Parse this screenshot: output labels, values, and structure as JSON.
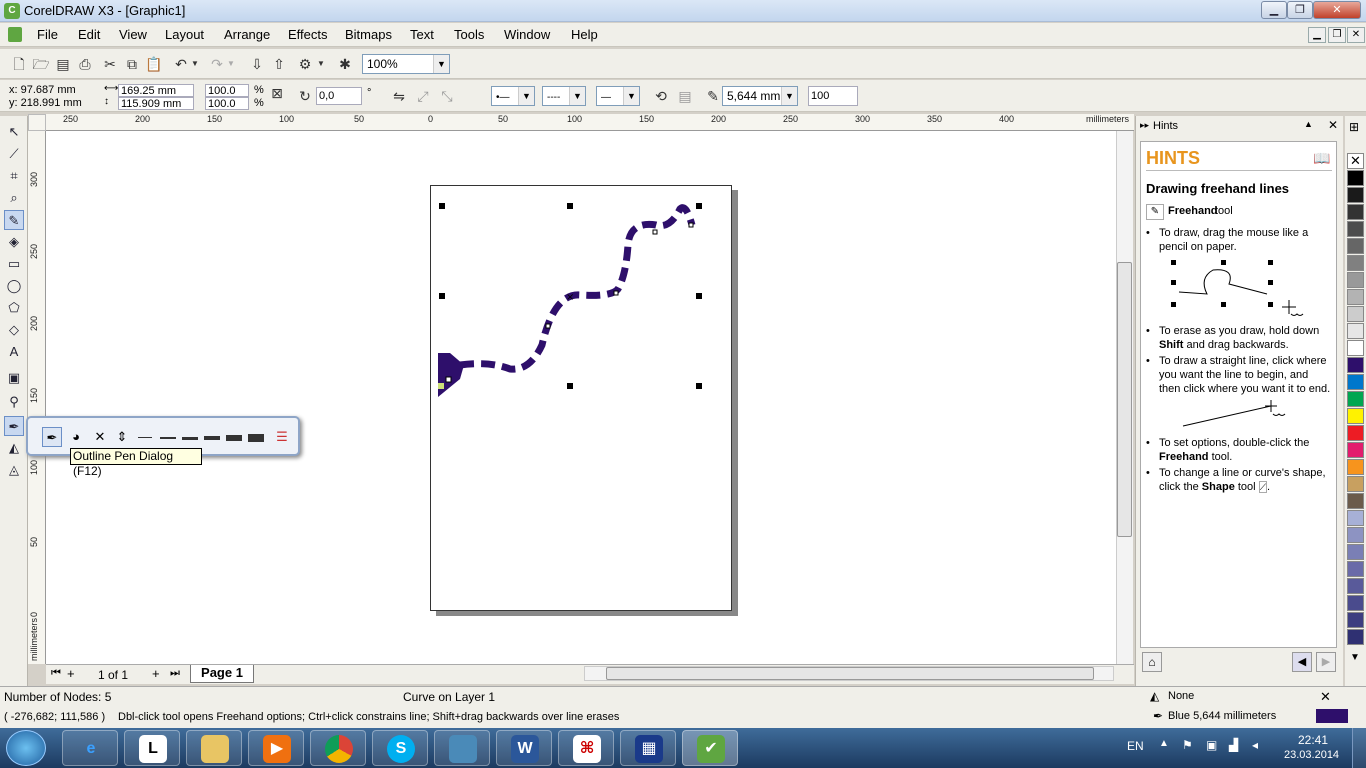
{
  "window": {
    "title": "CorelDRAW X3 - [Graphic1]",
    "min": "▁",
    "max": "❐",
    "close": "✕"
  },
  "menu": [
    "File",
    "Edit",
    "View",
    "Layout",
    "Arrange",
    "Effects",
    "Bitmaps",
    "Text",
    "Tools",
    "Window",
    "Help"
  ],
  "toolbar": {
    "zoom": "100%"
  },
  "property_bar": {
    "x": "x: 97.687 mm",
    "y": "y: 218.991 mm",
    "width": "169.25 mm",
    "height": "115.909 mm",
    "scale_x": "100.0",
    "scale_y": "100.0",
    "pct": "%",
    "angle": "0,0",
    "deg": "°",
    "outline_width": "5,644 mm",
    "smoothing": "100"
  },
  "ruler": {
    "units": "millimeters",
    "top": [
      "250",
      "200",
      "150",
      "100",
      "50",
      "0",
      "50",
      "100",
      "150",
      "200",
      "250",
      "300",
      "350",
      "400",
      "450"
    ],
    "left": [
      "300",
      "250",
      "200",
      "150",
      "100",
      "50",
      "0"
    ],
    "left_units": "millimeters"
  },
  "flyout": {
    "tooltip": "Outline Pen Dialog (F12)"
  },
  "page_nav": {
    "count": "1 of 1",
    "tab": "Page 1"
  },
  "hints": {
    "panel_title": "Hints",
    "heading": "HINTS",
    "subheading": "Drawing freehand lines",
    "tool_name": "Freehand",
    "tool_suffix": "tool",
    "b1": "To draw, drag the mouse like a pencil on paper.",
    "b2a": "To erase as you draw, hold down ",
    "b2b": "Shift",
    "b2c": " and drag backwards.",
    "b3": "To draw a straight line, click where you want the line to begin, and then click where you want it to end.",
    "b4a": "To set options, double-click the ",
    "b4b": "Freehand",
    "b4c": " tool.",
    "b5a": "To change a line or curve's shape, click the ",
    "b5b": "Shape",
    "b5c": " tool"
  },
  "status": {
    "nodes": "Number of Nodes: 5",
    "object": "Curve on Layer 1",
    "coords": "( -276,682; 111,586 )",
    "hint": "Dbl-click tool opens Freehand options; Ctrl+click constrains line; Shift+drag backwards over line erases",
    "fill": "None",
    "outline": "Blue  5,644 millimeters"
  },
  "colors": {
    "curve": "#2e0f6b"
  },
  "tray": {
    "lang": "EN",
    "time": "22:41",
    "date": "23.03.2014"
  }
}
